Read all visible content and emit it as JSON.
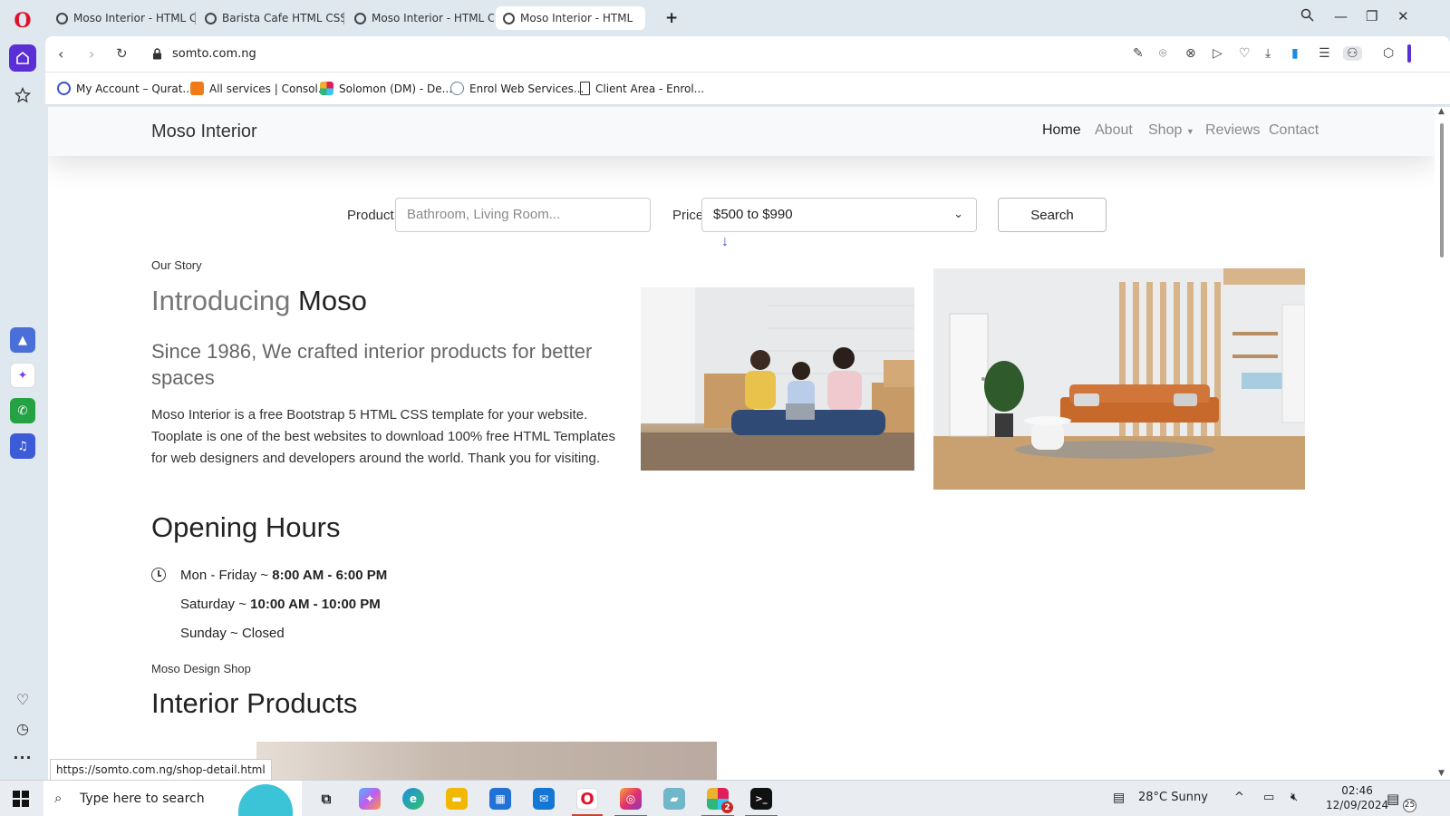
{
  "browser": {
    "tabs": [
      {
        "label": "Moso Interior - HTML CSS",
        "active": false
      },
      {
        "label": "Barista Cafe HTML CSS Te",
        "active": false
      },
      {
        "label": "Moso Interior - HTML CSS",
        "active": false
      },
      {
        "label": "Moso Interior - HTML",
        "active": true
      }
    ],
    "url": "somto.com.ng",
    "bookmarks": [
      {
        "label": "My Account – Qurat...",
        "icon": "qurat-icon",
        "color": "#3a4fd0"
      },
      {
        "label": "All services | Consol...",
        "icon": "console-icon",
        "color": "#ef7b18"
      },
      {
        "label": "Solomon (DM) - De...",
        "icon": "slack-icon",
        "color": "#c2185b"
      },
      {
        "label": "Enrol Web Services...",
        "icon": "globe-icon",
        "color": "#6a7b90"
      },
      {
        "label": "Client Area - Enrol...",
        "icon": "document-icon",
        "color": "#333333"
      }
    ],
    "status_url": "https://somto.com.ng/shop-detail.html"
  },
  "site": {
    "brand": "Moso Interior",
    "nav": [
      "Home",
      "About",
      "Shop",
      "Reviews",
      "Contact"
    ],
    "search": {
      "product_label": "Product",
      "product_placeholder": "Bathroom, Living Room...",
      "price_label": "Price",
      "price_value": "$500 to $990",
      "button": "Search"
    },
    "story": {
      "subtitle": "Our Story",
      "title_muted": "Introducing",
      "title_strong": "Moso",
      "lead": "Since 1986, We crafted interior products for better spaces",
      "body": "Moso Interior is a free Bootstrap 5 HTML CSS template for your website. Tooplate is one of the best websites to download 100% free HTML Templates for web designers and developers around the world. Thank you for visiting."
    },
    "hours": {
      "title": "Opening Hours",
      "rows": [
        {
          "day": "Mon - Friday ~ ",
          "time": "8:00 AM - 6:00 PM"
        },
        {
          "day": "Saturday ~ ",
          "time": "10:00 AM - 10:00 PM"
        },
        {
          "day": "Sunday ~ Closed",
          "time": ""
        }
      ]
    },
    "shop": {
      "subtitle": "Moso Design Shop",
      "title": "Interior Products"
    }
  },
  "taskbar": {
    "search_placeholder": "Type here to search",
    "weather": "28°C  Sunny",
    "time": "02:46",
    "date": "12/09/2024",
    "notifications": "25",
    "slack_badge": "2"
  },
  "colors": {
    "opera_red": "#e0112b",
    "opera_home": "#5b2fd6",
    "link_arrow": "#3a4fd0"
  }
}
